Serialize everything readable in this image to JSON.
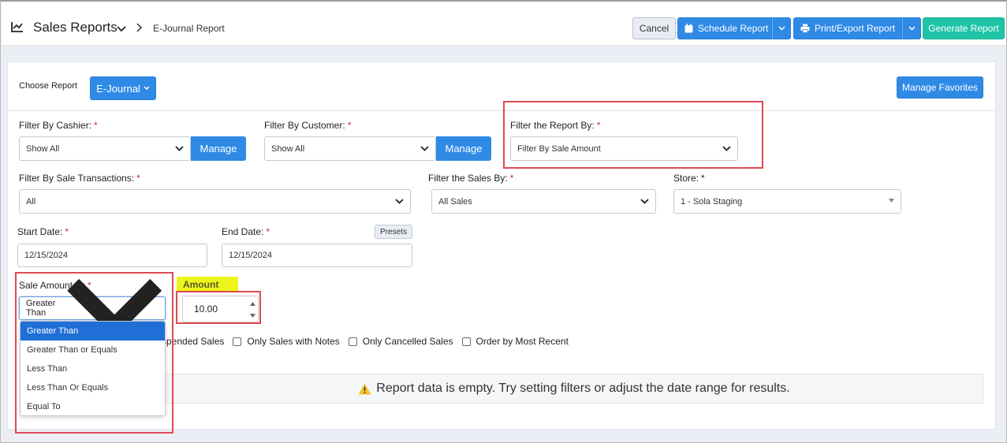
{
  "header": {
    "title": "Sales Reports",
    "breadcrumb": "E-Journal Report",
    "cancel_label": "Cancel",
    "schedule_label": "Schedule Report",
    "print_label": "Print/Export Report",
    "generate_label": "Generate Report"
  },
  "report_picker": {
    "label": "Choose Report",
    "value": "E-Journal",
    "favorites_label": "Manage Favorites"
  },
  "filters": {
    "cashier_label": "Filter By Cashier:",
    "cashier_value": "Show All",
    "customer_label": "Filter By Customer:",
    "customer_value": "Show All",
    "manage_label": "Manage",
    "report_by_label": "Filter the Report By:",
    "report_by_value": "Filter By Sale Amount",
    "transactions_label": "Filter By Sale Transactions:",
    "transactions_value": "All",
    "sales_by_label": "Filter the Sales By:",
    "sales_by_value": "All Sales",
    "store_label": "Store:",
    "store_value": "1 - Sola Staging",
    "required_mark": "*"
  },
  "dates": {
    "start_label": "Start Date:",
    "start_value": "12/15/2024",
    "end_label": "End Date:",
    "end_value": "12/15/2024",
    "presets_label": "Presets"
  },
  "sale_amount": {
    "label": "Sale Amount Is:",
    "value": "Greater Than",
    "options": [
      "Greater Than",
      "Greater Than or Equals",
      "Less Than",
      "Less Than Or Equals",
      "Equal To"
    ],
    "amount_label": "Amount",
    "amount_value": "10.00"
  },
  "checkboxes": {
    "suspended_partial": "spended Sales",
    "notes": "Only Sales with Notes",
    "cancelled": "Only Cancelled Sales",
    "recent": "Order by Most Recent"
  },
  "empty_message": "Report data is empty. Try setting filters or adjust the date range for results.",
  "colors": {
    "primary": "#2f8ae6",
    "generate": "#1fc4a6",
    "highlight_box": "#e04a52",
    "amount_highlight": "#eef51a",
    "selected_option": "#1f6fd6",
    "warning": "#f2c12e"
  }
}
